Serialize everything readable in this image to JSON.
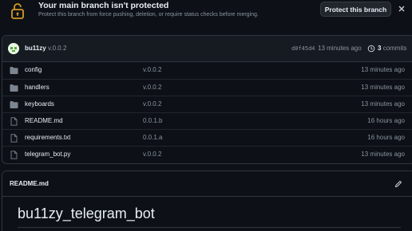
{
  "banner": {
    "title": "Your main branch isn't protected",
    "description": "Protect this branch from force pushing, deletion, or require status checks before merging.",
    "button_label": "Protect this branch",
    "icon": "unlock-icon",
    "close_icon": "close-icon"
  },
  "commit": {
    "author": "bu11zy",
    "message": "v.0.0.2",
    "hash": "d0f45d4",
    "time": "13 minutes ago",
    "count": "3",
    "count_label": "commits"
  },
  "files": [
    {
      "type": "folder",
      "name": "config",
      "commit": "v.0.0.2",
      "time": "13 minutes ago"
    },
    {
      "type": "folder",
      "name": "handlers",
      "commit": "v.0.0.2",
      "time": "13 minutes ago"
    },
    {
      "type": "folder",
      "name": "keyboards",
      "commit": "v.0.0.2",
      "time": "13 minutes ago"
    },
    {
      "type": "file",
      "name": "README.md",
      "commit": "0.0.1.b",
      "time": "16 hours ago"
    },
    {
      "type": "file",
      "name": "requirements.txt",
      "commit": "0.0.1.a",
      "time": "16 hours ago"
    },
    {
      "type": "file",
      "name": "telegram_bot.py",
      "commit": "v.0.0.2",
      "time": "13 minutes ago"
    }
  ],
  "readme": {
    "title": "README.md",
    "heading": "bu11zy_telegram_bot"
  },
  "colors": {
    "background": "#0d1117",
    "banner_icon": "#d29922",
    "folder_icon": "#7d8590",
    "text": "#e6edf3",
    "muted": "#8b949e"
  }
}
